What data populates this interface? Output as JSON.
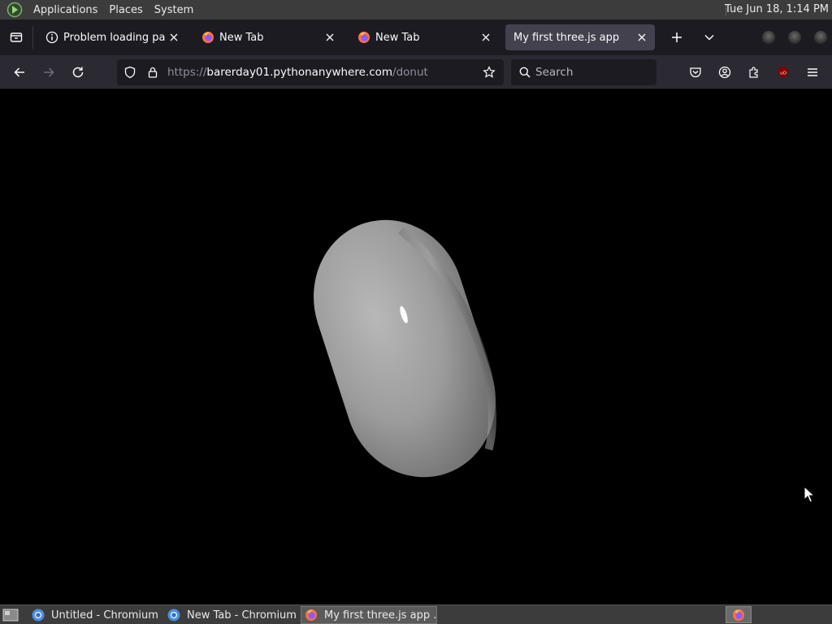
{
  "top_panel": {
    "menus": [
      "Applications",
      "Places",
      "System"
    ],
    "clock": "Tue Jun 18,  1:14 PM"
  },
  "tabs": [
    {
      "title": "Problem loading page",
      "icon": "info-icon",
      "active": false
    },
    {
      "title": "New Tab",
      "icon": "firefox-icon",
      "active": false
    },
    {
      "title": "New Tab",
      "icon": "firefox-icon",
      "active": false
    },
    {
      "title": "My first three.js app",
      "icon": "none",
      "active": true
    }
  ],
  "navbar": {
    "url_prefix": "https://",
    "url_host": "barerday01.pythonanywhere.com",
    "url_path": "/donut",
    "search_placeholder": "Search"
  },
  "colors": {
    "panel": "#3c3c3c",
    "tabstrip": "#1c1b22",
    "active_tab": "#42414d",
    "toolbar": "#2b2a33",
    "content_bg": "#000000",
    "donut_gray": "#9a9a9a"
  },
  "taskbar": {
    "items": [
      {
        "label": "Untitled - Chromium",
        "icon": "chromium-icon",
        "active": false
      },
      {
        "label": "New Tab - Chromium",
        "icon": "chromium-icon",
        "active": false
      },
      {
        "label": "My first three.js app ...",
        "icon": "firefox-icon",
        "active": true
      }
    ]
  }
}
